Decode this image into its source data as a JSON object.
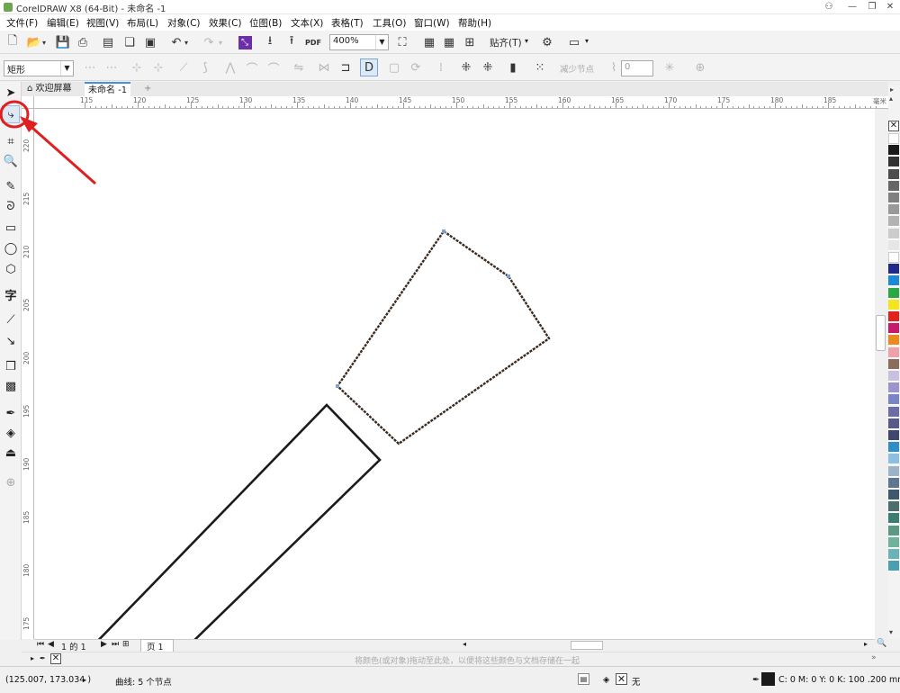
{
  "window": {
    "title": "CorelDRAW X8 (64-Bit) - 未命名 -1",
    "controls": [
      "minimize-icon",
      "restore-icon",
      "close-icon"
    ]
  },
  "menu": [
    "文件(F)",
    "编辑(E)",
    "视图(V)",
    "布局(L)",
    "对象(C)",
    "效果(C)",
    "位图(B)",
    "文本(X)",
    "表格(T)",
    "工具(O)",
    "窗口(W)",
    "帮助(H)"
  ],
  "toolbar": {
    "zoom_value": "400%",
    "snap_label": "贴齐(T)",
    "pdf_label": "PDF"
  },
  "property_bar": {
    "shape_type": "矩形",
    "reduce_nodes_label": "减少节点",
    "smoothness_value": "0"
  },
  "tabs": {
    "welcome": "欢迎屏幕",
    "document": "未命名 -1"
  },
  "ruler": {
    "h_labels": [
      "115",
      "120",
      "125",
      "130",
      "135",
      "140",
      "145",
      "150",
      "155",
      "160",
      "165",
      "170",
      "175",
      "180",
      "185"
    ],
    "unit": "毫米",
    "v_labels": [
      "220",
      "215",
      "210",
      "205",
      "200",
      "195",
      "190",
      "185",
      "180",
      "175"
    ]
  },
  "page_nav": {
    "current": "1",
    "of_label": "的",
    "total": "1",
    "page_tab": "页 1"
  },
  "doc_palette_hint": "将颜色(或对象)拖动至此处，以便将这些颜色与文档存储在一起",
  "status": {
    "coords": "(125.007, 173.034 )",
    "object_info": "曲线: 5 个节点",
    "fill_none": "无",
    "outline_info": "C: 0 M: 0 Y: 0 K: 100  .200 mm"
  },
  "colors": {
    "accent_annotation": "#e02020",
    "shape_outline": "#3a2a1e",
    "outline_swatch": "#1a1a1a"
  },
  "palette": [
    "#ffffff",
    "#1a1a1a",
    "#333333",
    "#4d4d4d",
    "#666666",
    "#808080",
    "#999999",
    "#b3b3b3",
    "#cccccc",
    "#e6e6e6",
    "#ffffff",
    "#1f2a8a",
    "#1a8ad6",
    "#2aa843",
    "#f5e61c",
    "#e3231b",
    "#c71a6d",
    "#eb8a1e",
    "#f0a0a8",
    "#8a6d5a",
    "#c8c0de",
    "#9c94cc",
    "#7a84c8",
    "#6c6ca8",
    "#5a5a88",
    "#3f4670",
    "#2f8ec8",
    "#8ac0e4",
    "#9cb4c8",
    "#5e7690",
    "#40586e",
    "#4e6e6e",
    "#3a7e72",
    "#5a9a84",
    "#70b29a",
    "#6ab4b8",
    "#4aa0b0"
  ]
}
